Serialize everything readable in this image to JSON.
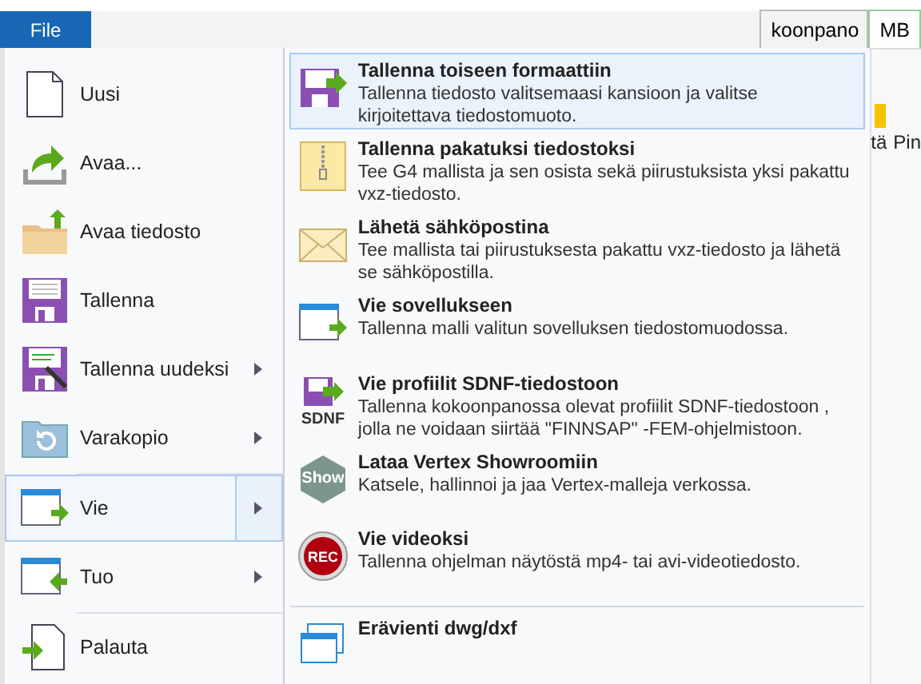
{
  "file_tab": {
    "label": "File"
  },
  "ribbon": {
    "tabs": [
      {
        "label": "koonpano"
      },
      {
        "label": "MB"
      }
    ],
    "labels": [
      "tä",
      "Pin"
    ]
  },
  "menu": {
    "items": [
      {
        "label": "Uusi",
        "kind": "page",
        "has_submenu": false,
        "selected": false,
        "divider_before": false
      },
      {
        "label": "Avaa...",
        "kind": "open",
        "has_submenu": false,
        "selected": false,
        "divider_before": false
      },
      {
        "label": "Avaa tiedosto",
        "kind": "folder",
        "has_submenu": false,
        "selected": false,
        "divider_before": false
      },
      {
        "label": "Tallenna",
        "kind": "floppy",
        "has_submenu": false,
        "selected": false,
        "divider_before": false
      },
      {
        "label": "Tallenna uudeksi",
        "kind": "floppy-pen",
        "has_submenu": true,
        "selected": false,
        "divider_before": false
      },
      {
        "label": "Varakopio",
        "kind": "backup",
        "has_submenu": true,
        "selected": false,
        "divider_before": false
      },
      {
        "label": "Vie",
        "kind": "export",
        "has_submenu": true,
        "selected": true,
        "divider_before": true
      },
      {
        "label": "Tuo",
        "kind": "import",
        "has_submenu": true,
        "selected": false,
        "divider_before": false
      },
      {
        "label": "Palauta",
        "kind": "restore",
        "has_submenu": false,
        "selected": false,
        "divider_before": true
      }
    ]
  },
  "submenu": {
    "items": [
      {
        "title": "Tallenna toiseen formaattiin",
        "description": "Tallenna tiedosto valitsemaasi kansioon ja valitse kirjoitettava tiedostomuoto.",
        "kind": "floppy-arrow",
        "selected": true,
        "divider_before": false
      },
      {
        "title": "Tallenna pakatuksi tiedostoksi",
        "description": "Tee G4 mallista ja sen osista sekä piirustuksista yksi pakattu vxz-tiedosto.",
        "kind": "zip",
        "selected": false,
        "divider_before": false
      },
      {
        "title": "Lähetä sähköpostina",
        "description": "Tee mallista tai piirustuksesta pakattu vxz-tiedosto ja lähetä se sähköpostilla.",
        "kind": "mail",
        "selected": false,
        "divider_before": false
      },
      {
        "title": "Vie sovellukseen",
        "description": "Tallenna malli valitun sovelluksen tiedostomuodossa.",
        "kind": "export",
        "selected": false,
        "divider_before": false
      },
      {
        "title": "Vie profiilit SDNF-tiedostoon",
        "description": "Tallenna kokoonpanossa olevat profiilit SDNF-tiedostoon , jolla ne voidaan siirtää \"FINNSAP\" -FEM-ohjelmistoon.",
        "kind": "sdnf",
        "icon_text": "SDNF",
        "selected": false,
        "divider_before": false
      },
      {
        "title": "Lataa Vertex Showroomiin",
        "description": "Katsele, hallinnoi ja jaa Vertex-malleja verkossa.",
        "kind": "show",
        "icon_text": "Show",
        "selected": false,
        "divider_before": false
      },
      {
        "title": "Vie videoksi",
        "description": "Tallenna ohjelman näytöstä mp4- tai avi-videotiedosto.",
        "kind": "rec",
        "icon_text": "REC",
        "selected": false,
        "divider_before": false
      },
      {
        "title": "Erävienti dwg/dxf",
        "kind": "batch",
        "selected": false,
        "divider_before": true
      }
    ]
  }
}
